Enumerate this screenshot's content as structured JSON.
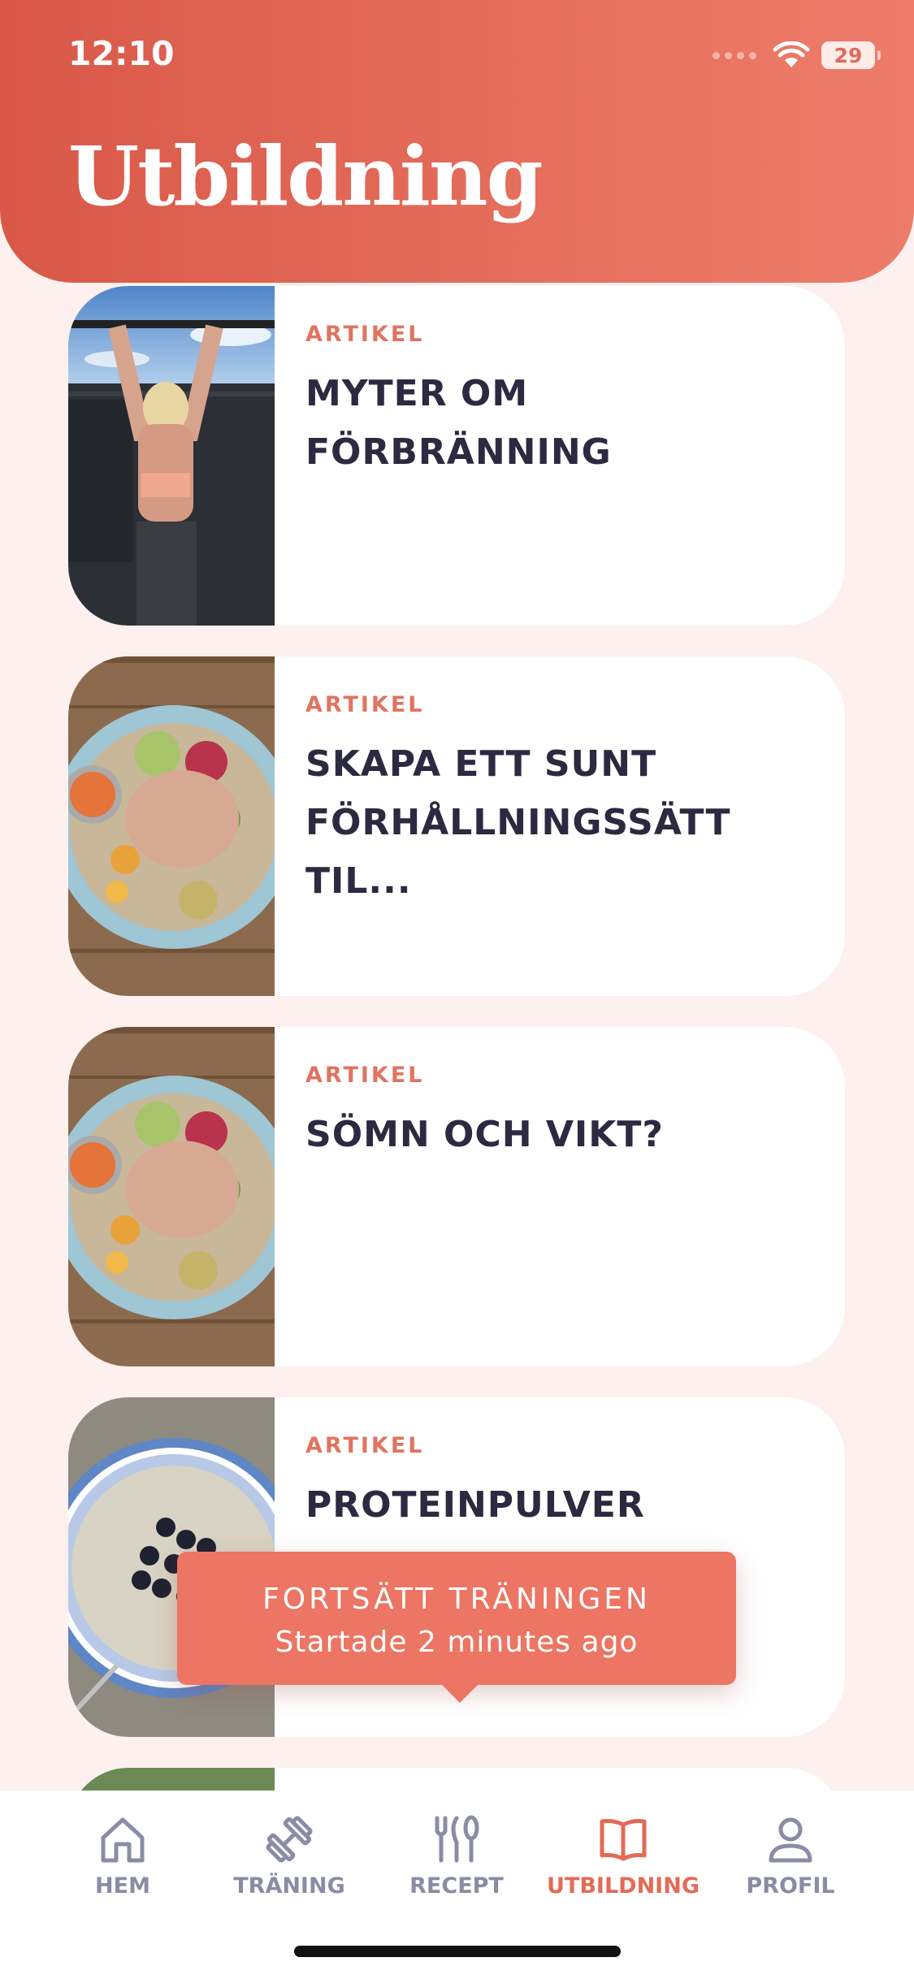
{
  "status_bar": {
    "time": "12:10",
    "battery": "29"
  },
  "header": {
    "title": "Utbildning"
  },
  "cards": [
    {
      "type": "ARTIKEL",
      "title": "MYTER OM FÖRBRÄNNING",
      "image": "woman-pullup-photo"
    },
    {
      "type": "ARTIKEL",
      "title": "SKAPA ETT SUNT FÖRHÅLLNINGSSÄTT TIL...",
      "image": "salad-bowl-photo"
    },
    {
      "type": "ARTIKEL",
      "title": "SÖMN OCH VIKT?",
      "image": "salad-bowl-photo"
    },
    {
      "type": "ARTIKEL",
      "title": "PROTEINPULVER",
      "image": "blueberry-bowl-photo"
    }
  ],
  "toast": {
    "title": "FORTSÄTT TRÄNINGEN",
    "subtitle": "Startade 2 minutes ago"
  },
  "tabbar": {
    "items": [
      {
        "label": "HEM",
        "icon": "home-icon"
      },
      {
        "label": "TRÄNING",
        "icon": "dumbbell-icon"
      },
      {
        "label": "RECEPT",
        "icon": "cutlery-icon"
      },
      {
        "label": "UTBILDNING",
        "icon": "book-icon",
        "active": true
      },
      {
        "label": "PROFIL",
        "icon": "person-icon"
      }
    ]
  },
  "colors": {
    "accent": "#e46a56",
    "header_gradient_start": "#d95848",
    "header_gradient_end": "#ee7c6a",
    "background": "#fdf0ef",
    "title_text": "#2b2a40",
    "tab_inactive": "#8a8ca5"
  }
}
